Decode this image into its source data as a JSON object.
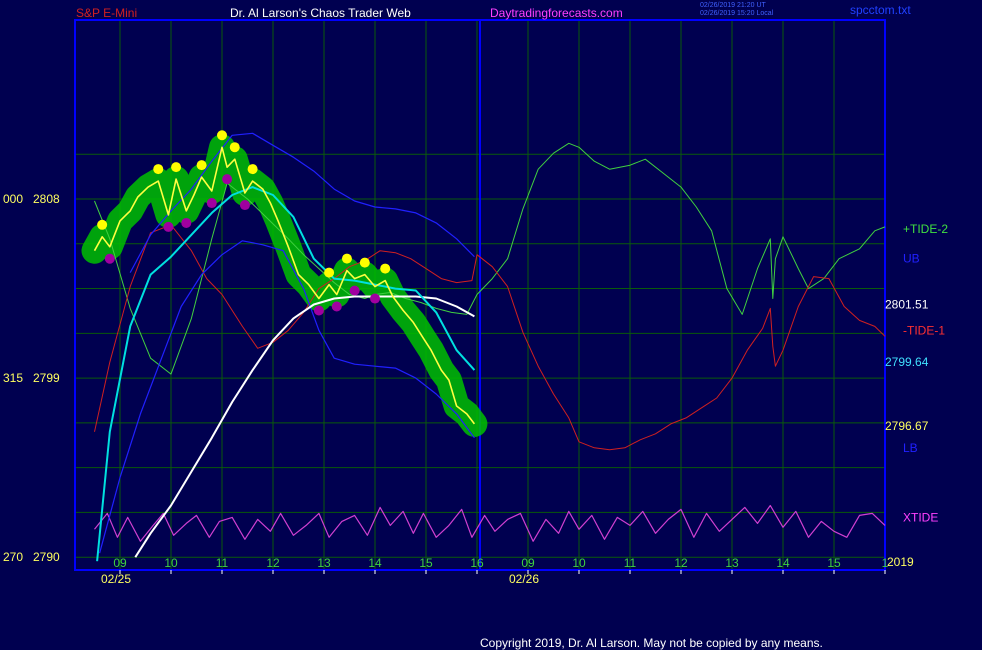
{
  "header": {
    "symbol": "S&P E-Mini",
    "site": "Dr. Al Larson's Chaos Trader Web",
    "url": "Daytradingforecasts.com",
    "time_ut": "02/26/2019 21:20 UT",
    "time_local": "02/26/2019 15:20 Local",
    "file": "spcctom.txt"
  },
  "footer": {
    "copyright": "Copyright 2019, Dr. Al Larson. May not be copied by any means."
  },
  "colors": {
    "background": "#000050",
    "frame": "#0000ff",
    "grid": "#0a5a0a",
    "price": "#ffff40",
    "price_band": "#00c000",
    "high_dots": "#ffff00",
    "low_dots": "#a000a0",
    "tide2": "#40d040",
    "tide1": "#d02020",
    "xtide": "#d040d0",
    "mid_band": "#00e0e0",
    "upper_lower_band": "#2020ff",
    "slow_avg": "#ffffff"
  },
  "chart_data": {
    "type": "line",
    "title": "S&P E-Mini",
    "xlabel": "",
    "ylabel": "",
    "ylim": [
      2790,
      2811
    ],
    "y_ticks": [
      {
        "value": 2808,
        "label": "2808",
        "left": "000"
      },
      {
        "value": 2799,
        "label": "2799",
        "left": "315"
      },
      {
        "value": 2790,
        "label": "2790",
        "left": "270"
      }
    ],
    "x_range": [
      8.5,
      24.0
    ],
    "x_ticks": [
      {
        "value": 9,
        "label": "09"
      },
      {
        "value": 10,
        "label": "10"
      },
      {
        "value": 11,
        "label": "11"
      },
      {
        "value": 12,
        "label": "12"
      },
      {
        "value": 13,
        "label": "13"
      },
      {
        "value": 14,
        "label": "14"
      },
      {
        "value": 15,
        "label": "15"
      },
      {
        "value": 16,
        "label": "16"
      },
      {
        "value": 17,
        "label": "09"
      },
      {
        "value": 18,
        "label": "10"
      },
      {
        "value": 19,
        "label": "11"
      },
      {
        "value": 20,
        "label": "12"
      },
      {
        "value": 21,
        "label": "13"
      },
      {
        "value": 22,
        "label": "14"
      },
      {
        "value": 23,
        "label": "15"
      },
      {
        "value": 24,
        "label": "1"
      }
    ],
    "day_labels": [
      {
        "x": 9.0,
        "label": "02/25"
      },
      {
        "x": 17.0,
        "label": "02/26"
      }
    ],
    "year_label": "2019",
    "series": [
      {
        "name": "price",
        "x": [
          8.5,
          8.65,
          8.8,
          9.0,
          9.2,
          9.35,
          9.55,
          9.75,
          9.95,
          10.1,
          10.3,
          10.45,
          10.6,
          10.8,
          11.0,
          11.1,
          11.25,
          11.45,
          11.6,
          11.8,
          11.95,
          12.1,
          12.3,
          12.5,
          12.7,
          12.9,
          13.1,
          13.25,
          13.45,
          13.6,
          13.8,
          14.0,
          14.2,
          14.35,
          14.55,
          14.75,
          14.95,
          15.1,
          15.3,
          15.45,
          15.6,
          15.8,
          15.95
        ],
        "y": [
          2805.4,
          2806.1,
          2805.6,
          2806.9,
          2807.4,
          2808.1,
          2808.6,
          2808.9,
          2807.2,
          2809.0,
          2807.4,
          2808.2,
          2809.1,
          2808.4,
          2810.6,
          2809.6,
          2810.0,
          2808.3,
          2808.9,
          2808.5,
          2807.8,
          2806.9,
          2805.6,
          2804.2,
          2803.7,
          2803.0,
          2803.7,
          2803.2,
          2804.4,
          2804.0,
          2804.2,
          2803.6,
          2803.9,
          2803.1,
          2802.4,
          2801.8,
          2801.0,
          2800.4,
          2799.4,
          2798.9,
          2797.6,
          2797.2,
          2796.7
        ]
      },
      {
        "name": "+TIDE-2",
        "x": [
          8.5,
          8.8,
          9.2,
          9.6,
          10.0,
          10.4,
          10.8,
          11.1,
          11.5,
          11.9,
          12.3,
          12.6,
          12.9,
          13.2,
          13.5,
          13.8,
          14.0,
          14.3,
          14.6,
          14.9,
          15.2,
          15.5,
          15.8,
          16.0,
          16.3,
          16.6,
          16.9,
          17.2,
          17.5,
          17.8,
          18.0,
          18.3,
          18.6,
          19.0,
          19.3,
          19.6,
          20.0,
          20.3,
          20.6,
          20.9,
          21.2,
          21.5,
          21.75,
          21.8,
          21.85,
          22.0,
          22.3,
          22.5,
          22.8,
          23.1,
          23.5,
          23.8,
          24.0
        ],
        "y": [
          2807.9,
          2806.0,
          2802.5,
          2800.0,
          2799.2,
          2802.0,
          2806.0,
          2808.8,
          2808.0,
          2807.0,
          2806.0,
          2805.2,
          2804.5,
          2803.8,
          2803.2,
          2803.0,
          2803.2,
          2803.3,
          2803.0,
          2802.8,
          2802.5,
          2802.3,
          2802.2,
          2803.2,
          2804.0,
          2805.0,
          2807.5,
          2809.5,
          2810.3,
          2810.8,
          2810.6,
          2809.9,
          2809.5,
          2809.7,
          2810.0,
          2809.4,
          2808.6,
          2807.6,
          2806.4,
          2803.5,
          2802.2,
          2804.5,
          2806.0,
          2803.0,
          2805.0,
          2806.1,
          2804.5,
          2803.5,
          2804.0,
          2805.0,
          2805.5,
          2806.4,
          2806.6
        ]
      },
      {
        "name": "-TIDE-1",
        "x": [
          8.5,
          8.8,
          9.2,
          9.6,
          10.0,
          10.4,
          10.7,
          11.0,
          11.4,
          11.7,
          12.0,
          12.3,
          12.6,
          12.9,
          13.2,
          13.5,
          13.8,
          14.1,
          14.4,
          14.7,
          15.0,
          15.3,
          15.6,
          15.9,
          16.0,
          16.3,
          16.6,
          16.9,
          17.2,
          17.5,
          17.8,
          18.0,
          18.3,
          18.6,
          18.9,
          19.2,
          19.5,
          19.8,
          20.1,
          20.4,
          20.7,
          21.0,
          21.3,
          21.6,
          21.75,
          21.8,
          21.85,
          22.0,
          22.3,
          22.6,
          22.9,
          23.2,
          23.5,
          23.8,
          24.0
        ],
        "y": [
          2796.3,
          2799.8,
          2803.6,
          2806.3,
          2806.7,
          2805.4,
          2804.0,
          2803.2,
          2801.6,
          2800.5,
          2800.8,
          2801.4,
          2802.3,
          2803.5,
          2804.0,
          2804.6,
          2804.9,
          2805.4,
          2805.3,
          2805.0,
          2804.5,
          2804.0,
          2803.8,
          2803.9,
          2805.2,
          2804.6,
          2803.6,
          2801.3,
          2799.6,
          2798.2,
          2797.0,
          2795.8,
          2795.5,
          2795.4,
          2795.5,
          2795.9,
          2796.2,
          2796.7,
          2797.0,
          2797.5,
          2798.0,
          2799.0,
          2800.4,
          2801.5,
          2802.5,
          2800.6,
          2799.6,
          2800.4,
          2802.6,
          2804.1,
          2804.0,
          2802.6,
          2801.9,
          2801.6,
          2801.1
        ]
      },
      {
        "name": "XTIDE",
        "x": [
          8.5,
          8.75,
          8.95,
          9.15,
          9.4,
          9.65,
          9.85,
          10.05,
          10.3,
          10.5,
          10.75,
          10.95,
          11.2,
          11.45,
          11.7,
          11.95,
          12.15,
          12.4,
          12.65,
          12.9,
          13.1,
          13.35,
          13.6,
          13.85,
          14.1,
          14.3,
          14.55,
          14.75,
          14.95,
          15.2,
          15.45,
          15.7,
          15.9,
          16.15,
          16.35,
          16.6,
          16.85,
          17.1,
          17.35,
          17.6,
          17.8,
          18.0,
          18.25,
          18.5,
          18.75,
          19.0,
          19.25,
          19.5,
          19.75,
          20.0,
          20.25,
          20.5,
          20.75,
          21.0,
          21.25,
          21.5,
          21.75,
          22.0,
          22.25,
          22.5,
          22.75,
          23.0,
          23.25,
          23.5,
          23.75,
          24.0
        ],
        "y": [
          2791.4,
          2792.2,
          2791.0,
          2792.0,
          2790.8,
          2791.6,
          2792.2,
          2791.1,
          2791.7,
          2792.1,
          2791.0,
          2791.8,
          2792.0,
          2790.9,
          2791.9,
          2791.3,
          2792.2,
          2791.1,
          2791.6,
          2792.2,
          2791.0,
          2791.8,
          2792.1,
          2791.1,
          2792.5,
          2791.6,
          2792.3,
          2791.2,
          2792.2,
          2791.0,
          2791.6,
          2792.4,
          2791.0,
          2792.1,
          2791.3,
          2791.9,
          2792.2,
          2790.8,
          2791.9,
          2791.2,
          2792.3,
          2791.4,
          2792.1,
          2790.9,
          2792.0,
          2791.6,
          2792.3,
          2791.2,
          2791.9,
          2792.4,
          2791.0,
          2792.2,
          2791.3,
          2791.9,
          2792.5,
          2791.7,
          2792.6,
          2791.5,
          2792.3,
          2791.0,
          2791.8,
          2791.3,
          2791.0,
          2792.1,
          2792.2,
          2791.6
        ]
      },
      {
        "name": "MB",
        "x": [
          8.55,
          8.8,
          9.2,
          9.6,
          10.0,
          10.4,
          10.8,
          11.2,
          11.6,
          12.0,
          12.4,
          12.8,
          13.2,
          13.6,
          14.0,
          14.4,
          14.8,
          15.2,
          15.6,
          15.95
        ],
        "y": [
          2789.8,
          2796.3,
          2801.6,
          2804.2,
          2805.1,
          2806.2,
          2807.3,
          2808.2,
          2808.6,
          2808.2,
          2807.1,
          2805.0,
          2804.0,
          2803.9,
          2803.7,
          2803.5,
          2803.4,
          2802.3,
          2800.4,
          2799.4
        ]
      },
      {
        "name": "UB",
        "x": [
          9.2,
          9.6,
          10.0,
          10.4,
          10.8,
          11.2,
          11.6,
          12.0,
          12.4,
          12.8,
          13.2,
          13.6,
          14.0,
          14.4,
          14.8,
          15.2,
          15.6,
          15.95
        ],
        "y": [
          2804.3,
          2806.2,
          2807.4,
          2808.5,
          2809.9,
          2811.2,
          2811.3,
          2810.7,
          2810.1,
          2809.4,
          2808.5,
          2807.9,
          2807.6,
          2807.5,
          2807.3,
          2806.8,
          2806.0,
          2805.1
        ]
      },
      {
        "name": "LB",
        "x": [
          8.6,
          9.0,
          9.4,
          9.8,
          10.2,
          10.6,
          11.0,
          11.4,
          11.8,
          12.2,
          12.6,
          12.9,
          13.2,
          13.6,
          14.0,
          14.4,
          14.8,
          15.2,
          15.6,
          15.95
        ],
        "y": [
          2790.2,
          2794.0,
          2797.2,
          2799.9,
          2802.6,
          2804.2,
          2805.2,
          2805.9,
          2805.7,
          2805.4,
          2803.5,
          2801.4,
          2800.0,
          2799.7,
          2799.6,
          2799.5,
          2799.0,
          2798.2,
          2797.2,
          2796.0
        ]
      },
      {
        "name": "slow",
        "x": [
          9.3,
          9.6,
          10.0,
          10.4,
          10.8,
          11.2,
          11.6,
          12.0,
          12.4,
          12.8,
          13.2,
          13.6,
          14.0,
          14.4,
          14.8,
          15.2,
          15.6,
          15.95
        ],
        "y": [
          2790.0,
          2791.2,
          2792.6,
          2794.3,
          2796.0,
          2797.8,
          2799.4,
          2800.9,
          2802.0,
          2802.7,
          2803.0,
          2803.1,
          2803.1,
          2803.1,
          2803.1,
          2803.0,
          2802.6,
          2802.1
        ]
      }
    ],
    "right_labels": [
      {
        "text": "+TIDE-2",
        "value": 2806.5,
        "color": "#40e040"
      },
      {
        "text": "UB",
        "value": 2805.0,
        "color": "#2020ff"
      },
      {
        "text": "2801.51",
        "value": 2802.7,
        "color": "#ffffff"
      },
      {
        "text": "-TIDE-1",
        "value": 2801.4,
        "color": "#ff3030"
      },
      {
        "text": "2799.64",
        "value": 2799.8,
        "color": "#40e0ff"
      },
      {
        "text": "2796.67",
        "value": 2796.6,
        "color": "#ffff60"
      },
      {
        "text": "LB",
        "value": 2795.5,
        "color": "#2020ff"
      },
      {
        "text": "XTIDE",
        "value": 2792.0,
        "color": "#ff40ff"
      }
    ],
    "grid": true
  }
}
